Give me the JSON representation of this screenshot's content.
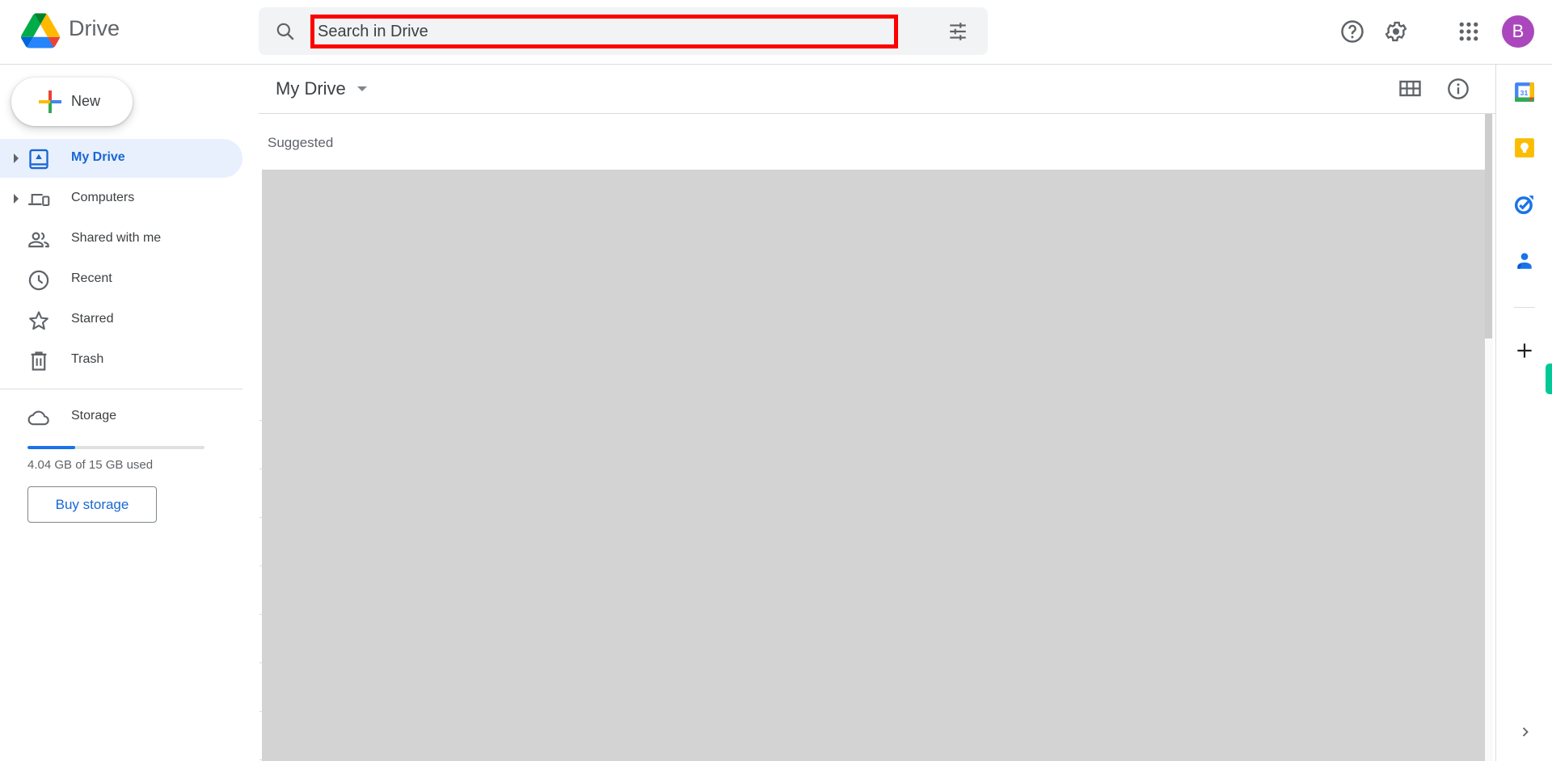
{
  "header": {
    "app_title": "Drive",
    "logo_icon": "google-drive-logo",
    "search": {
      "placeholder": "Search in Drive",
      "value": "",
      "search_icon": "search-icon",
      "filter_icon": "search-options-icon"
    },
    "icons": {
      "help": "help-icon",
      "settings": "gear-icon",
      "apps": "apps-grid-icon"
    },
    "avatar": {
      "initial": "B",
      "color": "#ab47bc"
    }
  },
  "sidebar": {
    "new_button": {
      "label": "New"
    },
    "items": [
      {
        "label": "My Drive",
        "icon": "my-drive-icon",
        "expandable": true,
        "active": true
      },
      {
        "label": "Computers",
        "icon": "computers-icon",
        "expandable": true,
        "active": false
      },
      {
        "label": "Shared with me",
        "icon": "shared-icon",
        "expandable": false,
        "active": false
      },
      {
        "label": "Recent",
        "icon": "clock-icon",
        "expandable": false,
        "active": false
      },
      {
        "label": "Starred",
        "icon": "star-icon",
        "expandable": false,
        "active": false
      },
      {
        "label": "Trash",
        "icon": "trash-icon",
        "expandable": false,
        "active": false
      }
    ],
    "storage": {
      "label": "Storage",
      "used_text": "4.04 GB of 15 GB used",
      "used_fraction": 0.269,
      "buy_button": "Buy storage"
    }
  },
  "main": {
    "title": "My Drive",
    "section_label": "Suggested",
    "toolbar": {
      "layout_icon": "grid-view-icon",
      "info_icon": "info-icon"
    },
    "content_state": "loading"
  },
  "right_panel": {
    "apps": [
      {
        "name": "Calendar",
        "icon": "calendar-icon",
        "badge": "31"
      },
      {
        "name": "Keep",
        "icon": "keep-icon"
      },
      {
        "name": "Tasks",
        "icon": "tasks-icon"
      },
      {
        "name": "Contacts",
        "icon": "contacts-icon"
      }
    ],
    "add_icon": "plus-icon",
    "expand_icon": "chevron-right-icon"
  },
  "colors": {
    "accent": "#1a73e8",
    "active_nav_bg": "#e8f0fe",
    "active_nav_text": "#1967d2",
    "search_highlight": "#ff0000",
    "loading_gray": "#d3d3d3"
  }
}
